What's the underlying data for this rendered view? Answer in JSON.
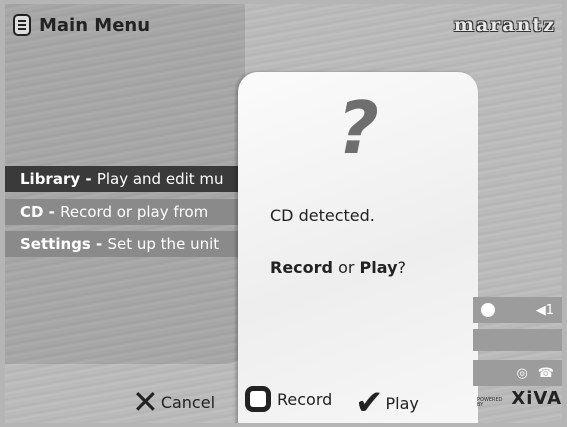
{
  "header": {
    "title": "Main Menu",
    "brand": "marantz"
  },
  "menu": {
    "items": [
      {
        "title": "Library - ",
        "desc": "Play and edit mu",
        "state": "selected"
      },
      {
        "title": "CD - ",
        "desc": "Record or play from",
        "state": "normal"
      },
      {
        "title": "Settings - ",
        "desc": "Set up the unit",
        "state": "normal"
      }
    ]
  },
  "dialog": {
    "icon": "?",
    "message": "CD detected.",
    "prompt_record": "Record",
    "prompt_or": " or ",
    "prompt_play": "Play",
    "prompt_end": "?"
  },
  "status": {
    "volume": "1",
    "icons": [
      "record-dot-icon",
      "speaker-icon",
      "cd-icon",
      "phone-icon"
    ]
  },
  "footer": {
    "cancel_label": "Cancel",
    "record_label": "Record",
    "play_label": "Play",
    "powered_by": "POWERED BY",
    "powered_brand": "XiVA"
  }
}
